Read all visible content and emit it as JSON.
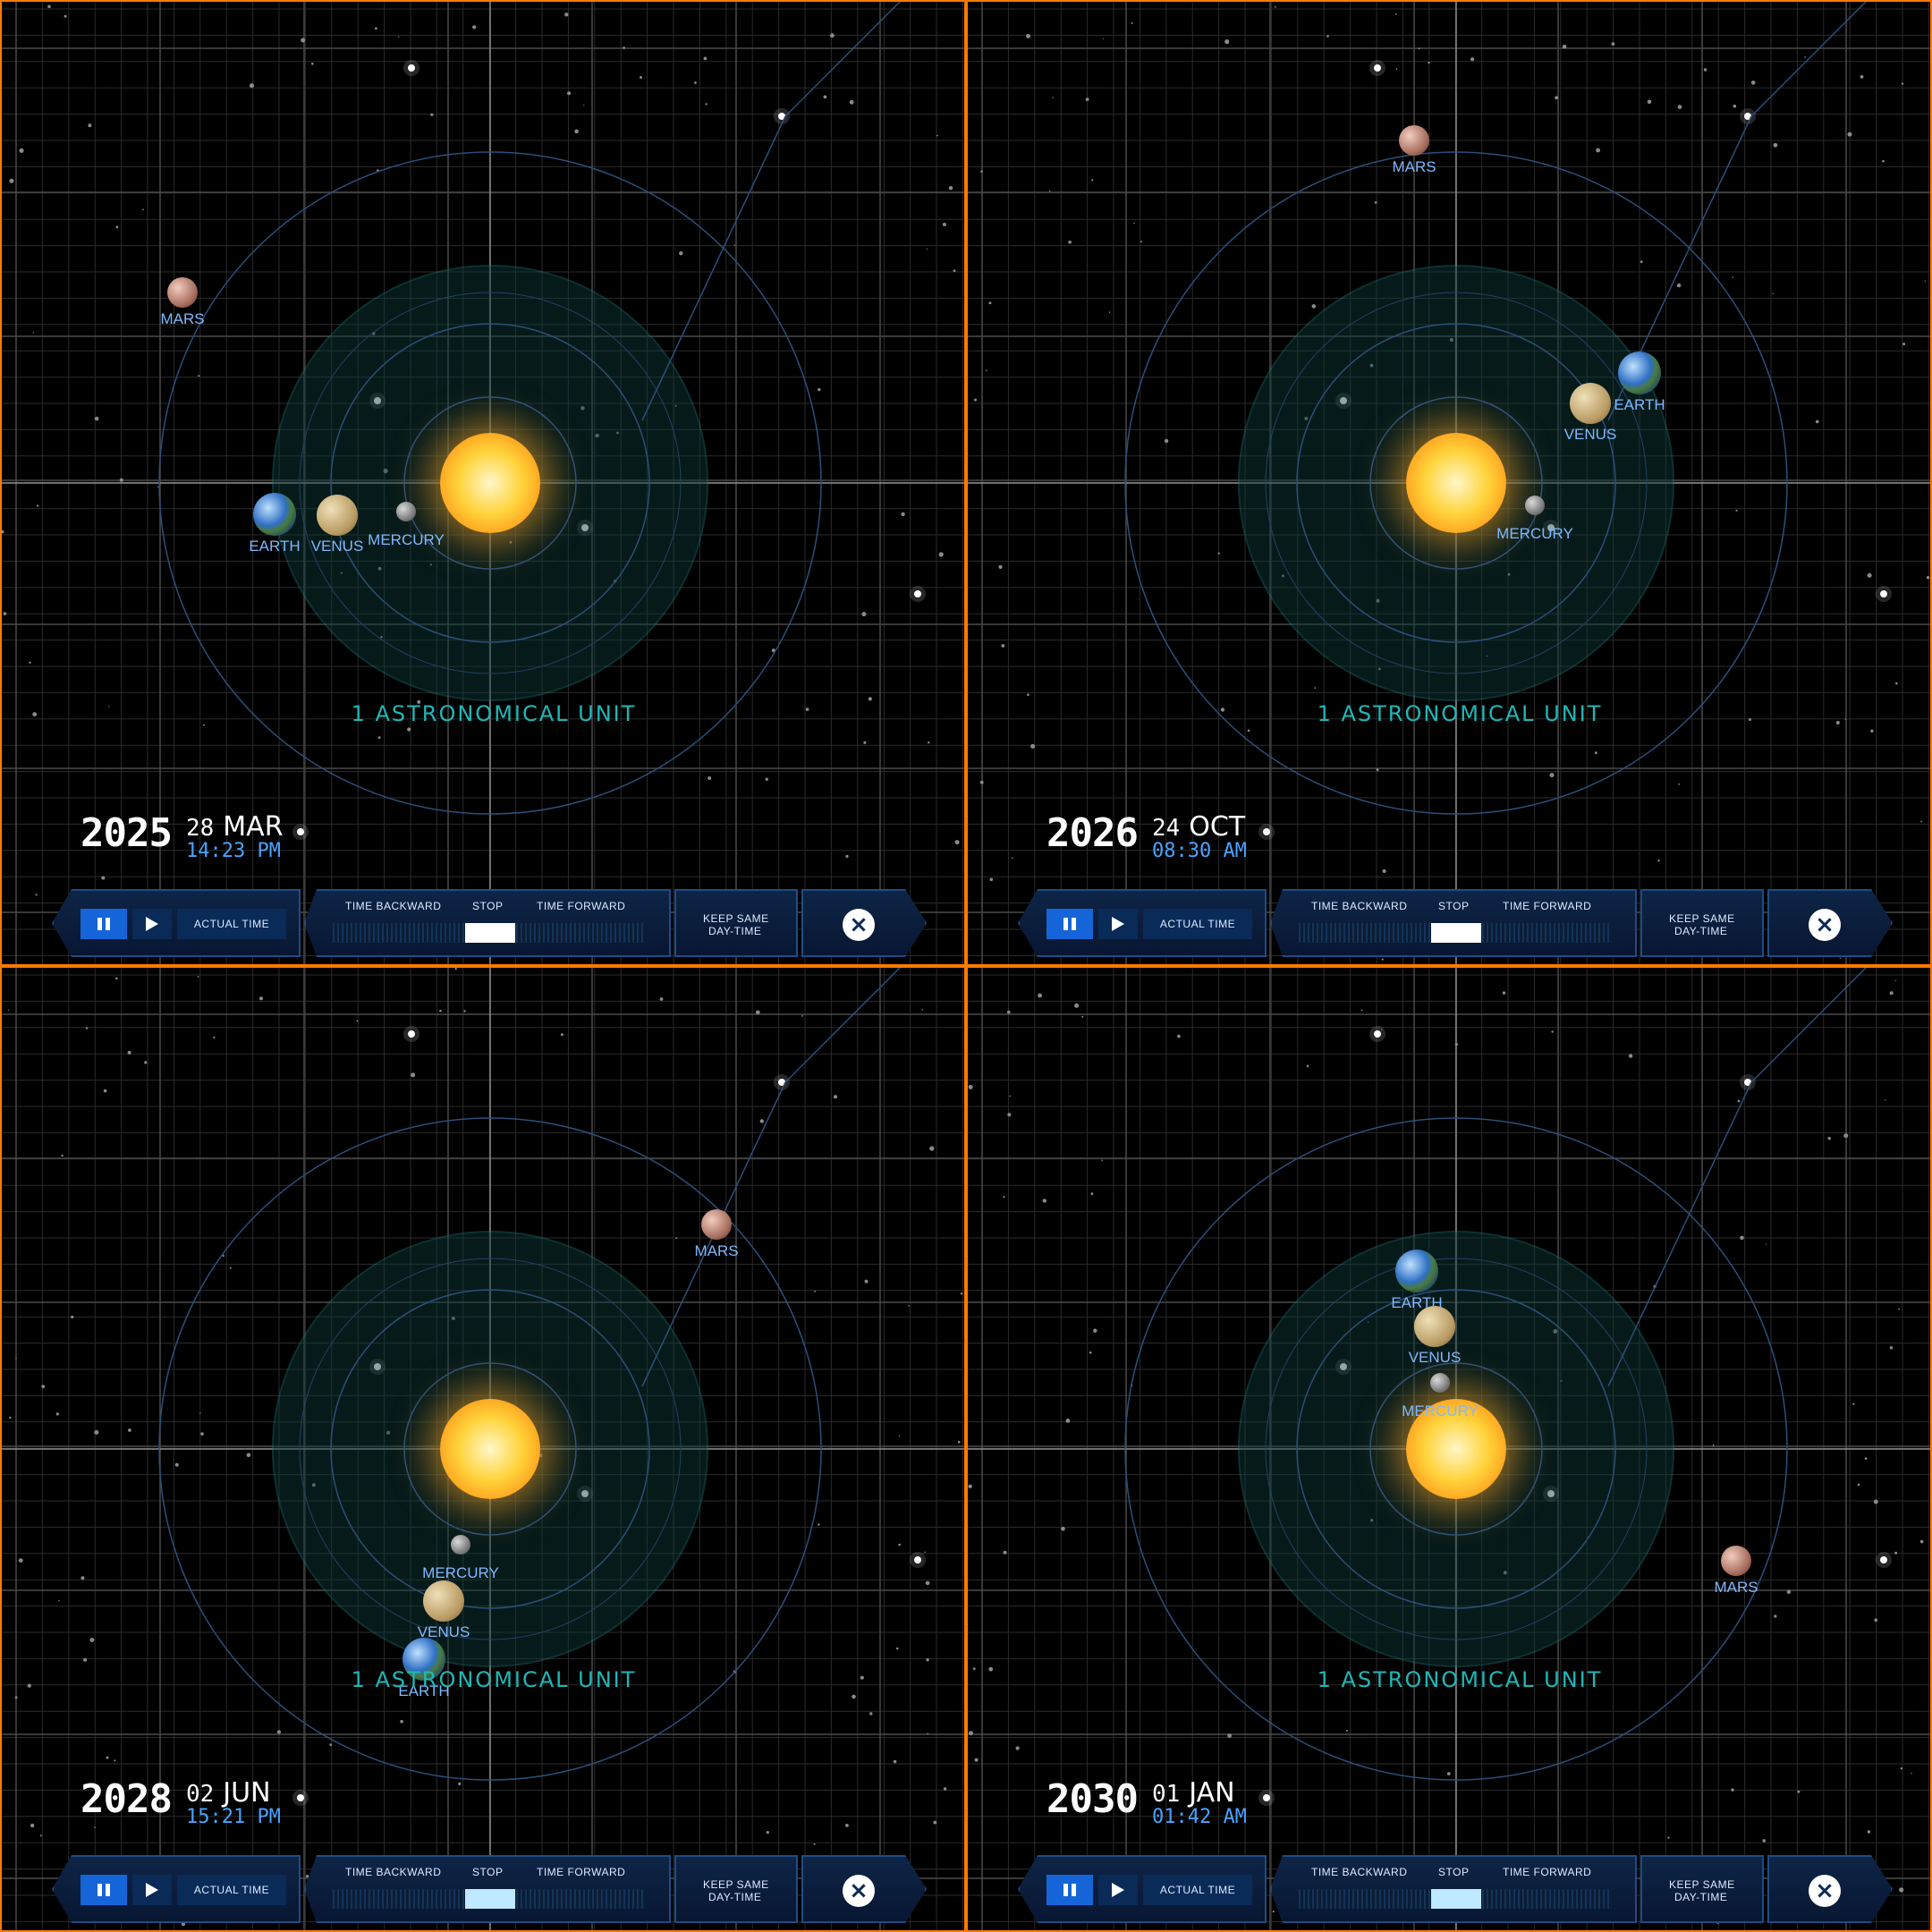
{
  "au_label": "1 ASTRONOMICAL UNIT",
  "toolbar": {
    "actual_time": "ACTUAL TIME",
    "time_backward": "TIME BACKWARD",
    "stop": "STOP",
    "time_forward": "TIME FORWARD",
    "keep_same_1": "KEEP SAME",
    "keep_same_2": "DAY-TIME"
  },
  "colors": {
    "border": "#ff7a00",
    "label": "#7fb8ff",
    "au": "#1fb7b7",
    "toolbar_bg": "#0e2546",
    "pause_btn": "#1565d8"
  },
  "icons": {
    "pause": "pause-icon",
    "play": "play-icon",
    "close": "close-icon"
  },
  "panels": [
    {
      "year": "2025",
      "day": "28",
      "month": "MAR",
      "time": "14:23 PM",
      "slider_thumb_color": "#ffffff",
      "planets": {
        "mercury": {
          "label": "MERCURY"
        },
        "venus": {
          "label": "VENUS"
        },
        "earth": {
          "label": "EARTH"
        },
        "mars": {
          "label": "MARS"
        }
      }
    },
    {
      "year": "2026",
      "day": "24",
      "month": "OCT",
      "time": "08:30 AM",
      "slider_thumb_color": "#ffffff",
      "planets": {
        "mercury": {
          "label": "MERCURY"
        },
        "venus": {
          "label": "VENUS"
        },
        "earth": {
          "label": "EARTH"
        },
        "mars": {
          "label": "MARS"
        }
      }
    },
    {
      "year": "2028",
      "day": "02",
      "month": "JUN",
      "time": "15:21 PM",
      "slider_thumb_color": "#bfe9ff",
      "planets": {
        "mercury": {
          "label": "MERCURY"
        },
        "venus": {
          "label": "VENUS"
        },
        "earth": {
          "label": "EARTH"
        },
        "mars": {
          "label": "MARS"
        }
      }
    },
    {
      "year": "2030",
      "day": "01",
      "month": "JAN",
      "time": "01:42 AM",
      "slider_thumb_color": "#bfe9ff",
      "planets": {
        "mercury": {
          "label": "MERCURY"
        },
        "venus": {
          "label": "VENUS"
        },
        "earth": {
          "label": "EARTH"
        },
        "mars": {
          "label": "MARS"
        }
      }
    }
  ]
}
